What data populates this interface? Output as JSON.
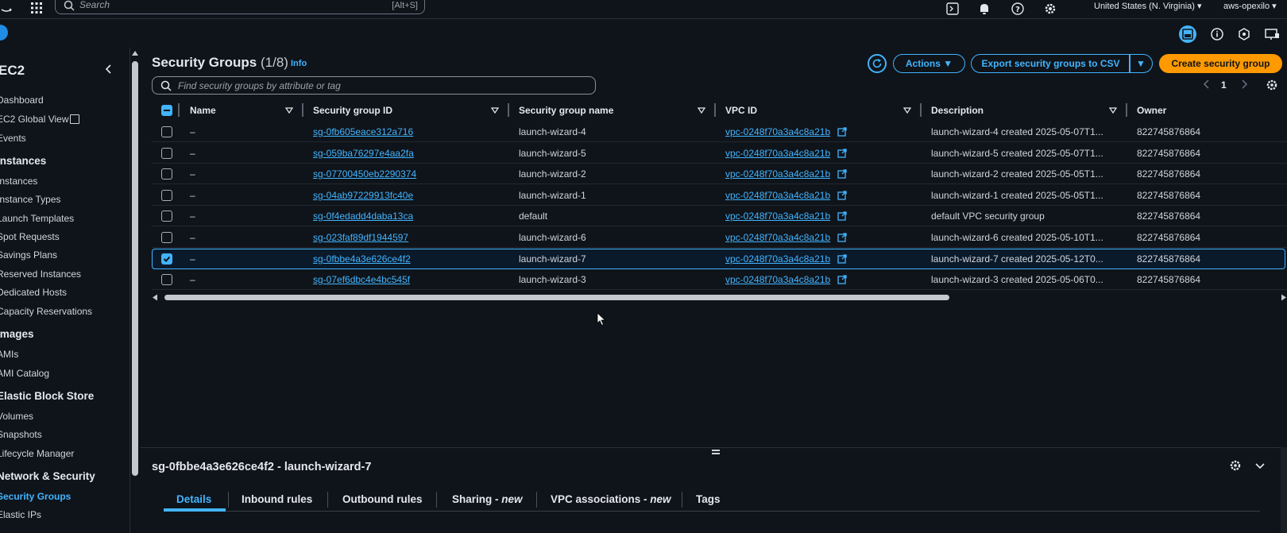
{
  "topnav": {
    "search_placeholder": "Search",
    "search_shortcut": "[Alt+S]",
    "region": "United States (N. Virginia) ▾",
    "account": "aws-opexilo ▾"
  },
  "sidebar": {
    "service_title": "EC2",
    "items": [
      {
        "label": "Dashboard",
        "type": "link"
      },
      {
        "label": "EC2 Global View",
        "type": "link"
      },
      {
        "label": "Events",
        "type": "link"
      },
      {
        "label": "Instances",
        "type": "head"
      },
      {
        "label": "Instances",
        "type": "link"
      },
      {
        "label": "Instance Types",
        "type": "link"
      },
      {
        "label": "Launch Templates",
        "type": "link"
      },
      {
        "label": "Spot Requests",
        "type": "link"
      },
      {
        "label": "Savings Plans",
        "type": "link"
      },
      {
        "label": "Reserved Instances",
        "type": "link"
      },
      {
        "label": "Dedicated Hosts",
        "type": "link"
      },
      {
        "label": "Capacity Reservations",
        "type": "link"
      },
      {
        "label": "Images",
        "type": "head"
      },
      {
        "label": "AMIs",
        "type": "link"
      },
      {
        "label": "AMI Catalog",
        "type": "link"
      },
      {
        "label": "Elastic Block Store",
        "type": "head"
      },
      {
        "label": "Volumes",
        "type": "link"
      },
      {
        "label": "Snapshots",
        "type": "link"
      },
      {
        "label": "Lifecycle Manager",
        "type": "link"
      },
      {
        "label": "Network & Security",
        "type": "head"
      },
      {
        "label": "Security Groups",
        "type": "active"
      },
      {
        "label": "Elastic IPs",
        "type": "link"
      }
    ]
  },
  "page": {
    "title": "Security Groups",
    "count": "(1/8)",
    "info": "Info",
    "actions_label": "Actions ▼",
    "export_label": "Export security groups to CSV",
    "export_caret": "▼",
    "create_label": "Create security group",
    "filter_placeholder": "Find security groups by attribute or tag",
    "page_number": "1"
  },
  "table": {
    "columns": [
      "Name",
      "Security group ID",
      "Security group name",
      "VPC ID",
      "Description",
      "Owner"
    ],
    "rows": [
      {
        "name": "–",
        "sg_id": "sg-0fb605eace312a716",
        "sg_name": "launch-wizard-4",
        "vpc": "vpc-0248f70a3a4c8a21b",
        "desc": "launch-wizard-4 created 2025-05-07T1...",
        "owner": "822745876864",
        "selected": false
      },
      {
        "name": "–",
        "sg_id": "sg-059ba76297e4aa2fa",
        "sg_name": "launch-wizard-5",
        "vpc": "vpc-0248f70a3a4c8a21b",
        "desc": "launch-wizard-5 created 2025-05-07T1...",
        "owner": "822745876864",
        "selected": false
      },
      {
        "name": "–",
        "sg_id": "sg-07700450eb2290374",
        "sg_name": "launch-wizard-2",
        "vpc": "vpc-0248f70a3a4c8a21b",
        "desc": "launch-wizard-2 created 2025-05-05T1...",
        "owner": "822745876864",
        "selected": false
      },
      {
        "name": "–",
        "sg_id": "sg-04ab97229913fc40e",
        "sg_name": "launch-wizard-1",
        "vpc": "vpc-0248f70a3a4c8a21b",
        "desc": "launch-wizard-1 created 2025-05-05T1...",
        "owner": "822745876864",
        "selected": false
      },
      {
        "name": "–",
        "sg_id": "sg-0f4edadd4daba13ca",
        "sg_name": "default",
        "vpc": "vpc-0248f70a3a4c8a21b",
        "desc": "default VPC security group",
        "owner": "822745876864",
        "selected": false
      },
      {
        "name": "–",
        "sg_id": "sg-023faf89df1944597",
        "sg_name": "launch-wizard-6",
        "vpc": "vpc-0248f70a3a4c8a21b",
        "desc": "launch-wizard-6 created 2025-05-10T1...",
        "owner": "822745876864",
        "selected": false
      },
      {
        "name": "–",
        "sg_id": "sg-0fbbe4a3e626ce4f2",
        "sg_name": "launch-wizard-7",
        "vpc": "vpc-0248f70a3a4c8a21b",
        "desc": "launch-wizard-7 created 2025-05-12T0...",
        "owner": "822745876864",
        "selected": true
      },
      {
        "name": "–",
        "sg_id": "sg-07ef6dbc4e4bc545f",
        "sg_name": "launch-wizard-3",
        "vpc": "vpc-0248f70a3a4c8a21b",
        "desc": "launch-wizard-3 created 2025-05-06T0...",
        "owner": "822745876864",
        "selected": false
      }
    ]
  },
  "split_panel": {
    "title": "sg-0fbbe4a3e626ce4f2 - launch-wizard-7",
    "tabs": [
      {
        "label": "Details",
        "suffix": ""
      },
      {
        "label": "Inbound rules",
        "suffix": ""
      },
      {
        "label": "Outbound rules",
        "suffix": ""
      },
      {
        "label": "Sharing - ",
        "suffix": "new"
      },
      {
        "label": "VPC associations - ",
        "suffix": "new"
      },
      {
        "label": "Tags",
        "suffix": ""
      }
    ]
  },
  "colors": {
    "background": "#0f141a",
    "link": "#42b4ff",
    "primary_button": "#ff9900",
    "selected_row": "#0a1a2b"
  }
}
